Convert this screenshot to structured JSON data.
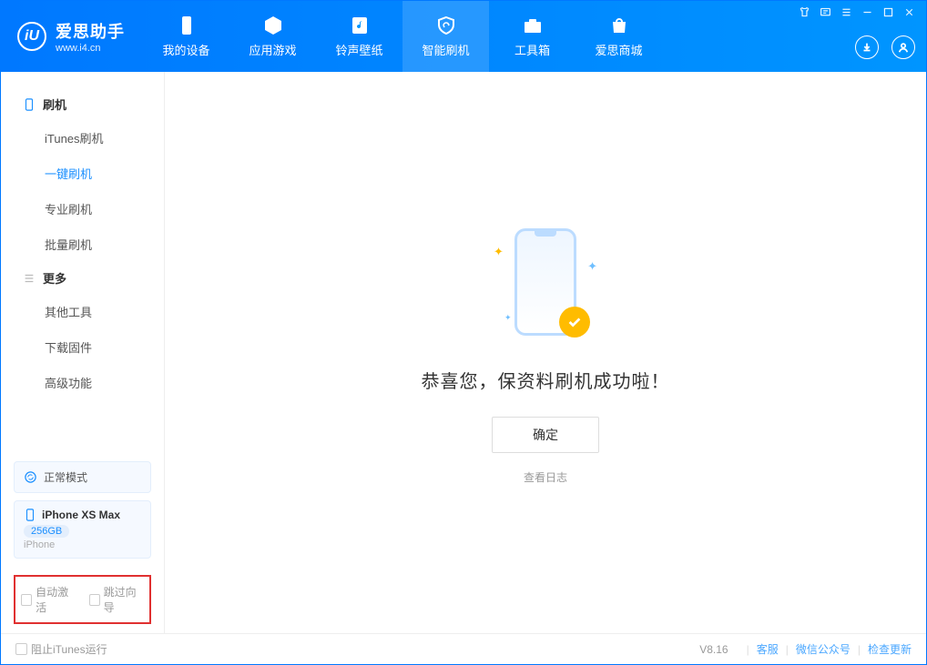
{
  "app": {
    "title": "爱思助手",
    "subtitle": "www.i4.cn"
  },
  "nav": {
    "items": [
      {
        "label": "我的设备"
      },
      {
        "label": "应用游戏"
      },
      {
        "label": "铃声壁纸"
      },
      {
        "label": "智能刷机"
      },
      {
        "label": "工具箱"
      },
      {
        "label": "爱思商城"
      }
    ]
  },
  "sidebar": {
    "group1_title": "刷机",
    "group1_items": [
      {
        "label": "iTunes刷机"
      },
      {
        "label": "一键刷机"
      },
      {
        "label": "专业刷机"
      },
      {
        "label": "批量刷机"
      }
    ],
    "group2_title": "更多",
    "group2_items": [
      {
        "label": "其他工具"
      },
      {
        "label": "下载固件"
      },
      {
        "label": "高级功能"
      }
    ],
    "status_label": "正常模式",
    "device": {
      "name": "iPhone XS Max",
      "storage": "256GB",
      "type": "iPhone"
    },
    "auto_activate": "自动激活",
    "skip_guide": "跳过向导"
  },
  "content": {
    "success_message": "恭喜您，保资料刷机成功啦！",
    "ok_button": "确定",
    "view_log": "查看日志"
  },
  "footer": {
    "block_itunes": "阻止iTunes运行",
    "version": "V8.16",
    "customer_service": "客服",
    "wechat": "微信公众号",
    "check_update": "检查更新"
  }
}
